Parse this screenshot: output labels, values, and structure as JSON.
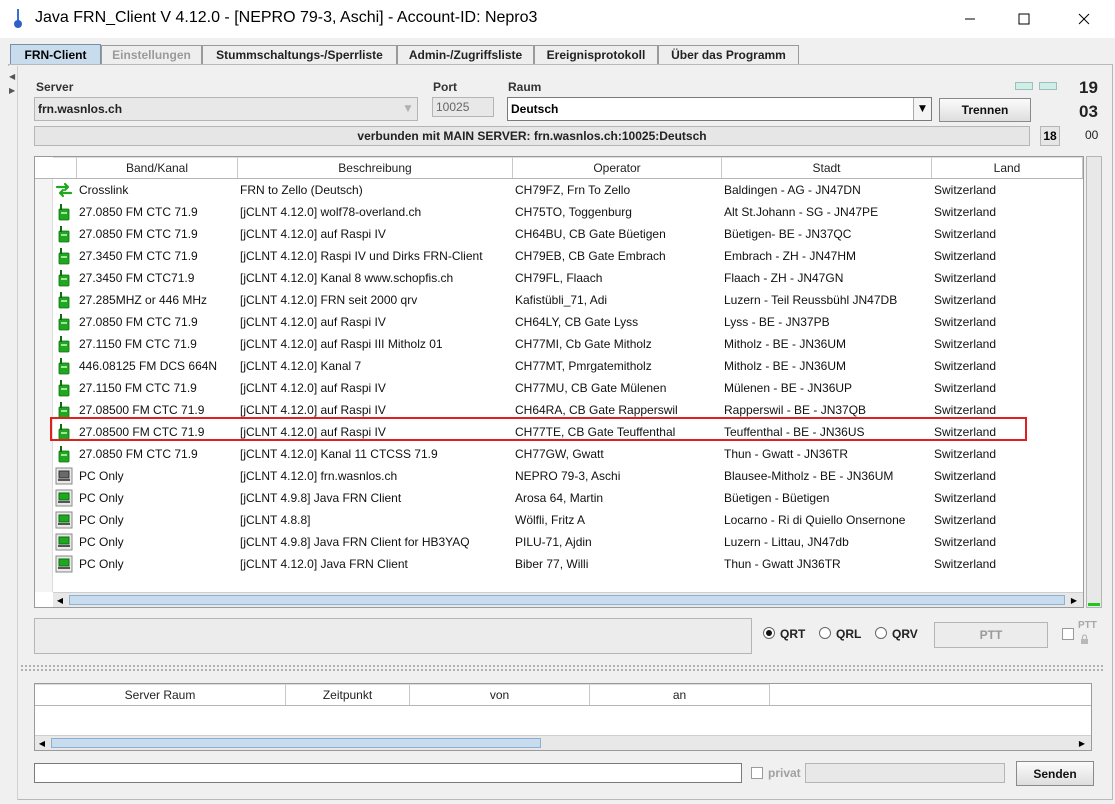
{
  "window": {
    "title": "Java FRN_Client V 4.12.0 - [NEPRO 79-3, Aschi] - Account-ID: Nepro3"
  },
  "tabs": [
    {
      "label": "FRN-Client",
      "state": "active"
    },
    {
      "label": "Einstellungen",
      "state": "disabled"
    },
    {
      "label": "Stummschaltungs-/Sperrliste",
      "state": "normal"
    },
    {
      "label": "Admin-/Zugriffsliste",
      "state": "normal"
    },
    {
      "label": "Ereignisprotokoll",
      "state": "normal"
    },
    {
      "label": "Über das Programm",
      "state": "normal"
    }
  ],
  "connection": {
    "server_label": "Server",
    "server_value": "frn.wasnlos.ch",
    "port_label": "Port",
    "port_value": "10025",
    "room_label": "Raum",
    "room_value": "Deutsch",
    "disconnect_button": "Trennen",
    "status_text": "verbunden mit  MAIN SERVER: frn.wasnlos.ch:10025:Deutsch",
    "user_count": "18"
  },
  "clock": {
    "hours": "19",
    "minutes": "03",
    "seconds": "00"
  },
  "client_table": {
    "columns": [
      "Band/Kanal",
      "Beschreibung",
      "Operator",
      "Stadt",
      "Land"
    ],
    "highlight_row": 11,
    "rows": [
      {
        "icon": "crosslink-icon",
        "band": "Crosslink",
        "desc": "FRN to Zello (Deutsch)",
        "op": "CH79FZ, Frn To Zello",
        "city": "Baldingen - AG - JN47DN",
        "country": "Switzerland"
      },
      {
        "icon": "gateway-radio-icon",
        "band": "27.0850 FM CTC 71.9",
        "desc": "[jCLNT 4.12.0] wolf78-overland.ch",
        "op": "CH75TO, Toggenburg",
        "city": "Alt St.Johann - SG - JN47PE",
        "country": "Switzerland"
      },
      {
        "icon": "gateway-radio-icon",
        "band": "27.0850 FM CTC 71.9",
        "desc": "[jCLNT 4.12.0] auf Raspi IV",
        "op": "CH64BU, CB Gate Büetigen",
        "city": "Büetigen- BE - JN37QC",
        "country": "Switzerland"
      },
      {
        "icon": "gateway-radio-icon",
        "band": "27.3450 FM CTC 71.9",
        "desc": "[jCLNT 4.12.0] Raspi IV und Dirks FRN-Client",
        "op": "CH79EB, CB Gate Embrach",
        "city": "Embrach - ZH - JN47HM",
        "country": "Switzerland"
      },
      {
        "icon": "gateway-radio-icon",
        "band": "27.3450 FM CTC71.9",
        "desc": "[jCLNT 4.12.0] Kanal 8  www.schopfis.ch",
        "op": "CH79FL, Flaach",
        "city": "Flaach - ZH - JN47GN",
        "country": "Switzerland"
      },
      {
        "icon": "gateway-radio-icon",
        "band": "27.285MHZ or 446 MHz",
        "desc": "[jCLNT 4.12.0] FRN seit 2000 qrv",
        "op": "Kafistübli_71, Adi",
        "city": "Luzern - Teil Reussbühl JN47DB",
        "country": "Switzerland"
      },
      {
        "icon": "gateway-radio-icon",
        "band": "27.0850 FM CTC 71.9",
        "desc": "[jCLNT 4.12.0] auf Raspi IV",
        "op": "CH64LY, CB Gate Lyss",
        "city": "Lyss - BE - JN37PB",
        "country": "Switzerland"
      },
      {
        "icon": "gateway-radio-icon",
        "band": "27.1150 FM CTC 71.9",
        "desc": "[jCLNT 4.12.0] auf Raspi III  Mitholz 01",
        "op": "CH77MI, Cb Gate Mitholz",
        "city": "Mitholz - BE - JN36UM",
        "country": "Switzerland"
      },
      {
        "icon": "gateway-radio-icon",
        "band": "446.08125 FM DCS 664N",
        "desc": "[jCLNT 4.12.0] Kanal 7",
        "op": "CH77MT, Pmrgatemitholz",
        "city": "Mitholz - BE - JN36UM",
        "country": "Switzerland"
      },
      {
        "icon": "gateway-radio-icon",
        "band": "27.1150 FM CTC 71.9",
        "desc": "[jCLNT 4.12.0] auf Raspi IV",
        "op": "CH77MU, CB Gate Mülenen",
        "city": "Mülenen - BE - JN36UP",
        "country": "Switzerland"
      },
      {
        "icon": "gateway-radio-icon",
        "band": "27.08500 FM CTC 71.9",
        "desc": "[jCLNT 4.12.0] auf Raspi IV",
        "op": "CH64RA, CB Gate Rapperswil",
        "city": "Rapperswil - BE - JN37QB",
        "country": "Switzerland"
      },
      {
        "icon": "gateway-radio-icon",
        "band": "27.08500 FM CTC 71.9",
        "desc": "[jCLNT 4.12.0] auf Raspi IV",
        "op": "CH77TE, CB Gate Teuffenthal",
        "city": "Teuffenthal - BE - JN36US",
        "country": "Switzerland"
      },
      {
        "icon": "gateway-radio-icon",
        "band": "27.0850 FM CTC 71.9",
        "desc": "[jCLNT 4.12.0] Kanal 11 CTCSS 71.9",
        "op": "CH77GW, Gwatt",
        "city": "Thun - Gwatt - JN36TR",
        "country": "Switzerland"
      },
      {
        "icon": "pc-gray-icon",
        "band": "PC Only",
        "desc": "[jCLNT 4.12.0] frn.wasnlos.ch",
        "op": "NEPRO 79-3, Aschi",
        "city": "Blausee-Mitholz - BE - JN36UM",
        "country": "Switzerland"
      },
      {
        "icon": "pc-green-icon",
        "band": "PC Only",
        "desc": "[jCLNT 4.9.8] Java FRN Client",
        "op": "Arosa 64, Martin",
        "city": "Büetigen - Büetigen",
        "country": "Switzerland"
      },
      {
        "icon": "pc-green-icon",
        "band": "PC Only",
        "desc": "[jCLNT 4.8.8]",
        "op": "Wölfli, Fritz A",
        "city": "Locarno - Ri di Quiello Onsernone",
        "country": "Switzerland"
      },
      {
        "icon": "pc-green-icon",
        "band": "PC Only",
        "desc": "[jCLNT 4.9.8] Java FRN Client for HB3YAQ",
        "op": "PILU-71, Ajdin",
        "city": "Luzern - Littau, JN47db",
        "country": "Switzerland"
      },
      {
        "icon": "pc-green-icon",
        "band": "PC Only",
        "desc": "[jCLNT 4.12.0] Java FRN Client",
        "op": "Biber 77, Willi",
        "city": "Thun - Gwatt JN36TR",
        "country": "Switzerland"
      }
    ]
  },
  "transmit": {
    "radio_qrt": "QRT",
    "radio_qrl": "QRL",
    "radio_qrv": "QRV",
    "selected": "QRT",
    "ptt_button": "PTT",
    "ptt_lock_label": "PTT"
  },
  "messages_table": {
    "columns": [
      "Server Raum",
      "Zeitpunkt",
      "von",
      "an"
    ]
  },
  "chat": {
    "input_value": "",
    "private_label": "privat",
    "send_button": "Senden"
  },
  "colors": {
    "active_tab": "#c8dcee",
    "highlight_border": "#e02020",
    "level_indicator": "#1ec81e",
    "led_off": "#cfeee8"
  }
}
